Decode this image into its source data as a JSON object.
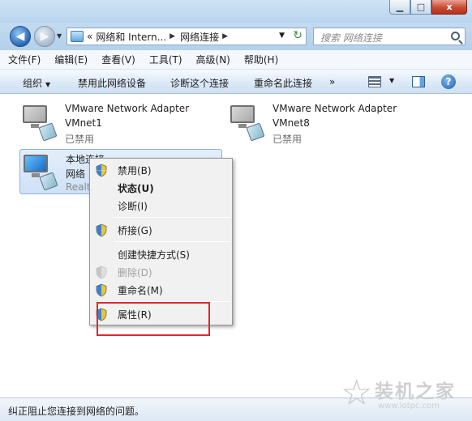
{
  "window": {
    "caption_minimize": "▁",
    "caption_maximize": "□",
    "caption_close": "x"
  },
  "address": {
    "prefix": "«",
    "breadcrumbs": [
      "网络和 Intern...",
      "网络连接"
    ],
    "search_placeholder": "搜索 网络连接"
  },
  "menubar": [
    "文件(F)",
    "编辑(E)",
    "查看(V)",
    "工具(T)",
    "高级(N)",
    "帮助(H)"
  ],
  "toolbar": {
    "organize": "组织",
    "disable_device": "禁用此网络设备",
    "diagnose": "诊断这个连接",
    "rename": "重命名此连接",
    "more": "»",
    "help": "?"
  },
  "adapters": [
    {
      "name": "VMware Network Adapter",
      "sub": "VMnet1",
      "status": "已禁用",
      "icon": "disabled-adapter-icon"
    },
    {
      "name": "VMware Network Adapter",
      "sub": "VMnet8",
      "status": "已禁用",
      "icon": "disabled-adapter-icon"
    },
    {
      "name": "本地连接",
      "sub": "网络",
      "status": "Realt",
      "icon": "local-connection-icon"
    }
  ],
  "context_menu": [
    {
      "label": "禁用(B)",
      "icon": "shield",
      "bold": false,
      "disabled": false
    },
    {
      "label": "状态(U)",
      "icon": null,
      "bold": true,
      "disabled": false
    },
    {
      "label": "诊断(I)",
      "icon": null,
      "bold": false,
      "disabled": false
    },
    {
      "label": "桥接(G)",
      "icon": "shield",
      "bold": false,
      "disabled": false
    },
    {
      "label": "创建快捷方式(S)",
      "icon": null,
      "bold": false,
      "disabled": false
    },
    {
      "label": "删除(D)",
      "icon": "shield",
      "bold": false,
      "disabled": true
    },
    {
      "label": "重命名(M)",
      "icon": "shield",
      "bold": false,
      "disabled": false
    },
    {
      "label": "属性(R)",
      "icon": "shield",
      "bold": false,
      "disabled": false
    }
  ],
  "statusbar": {
    "text": "纠正阻止您连接到网络的问题。"
  },
  "watermark": {
    "title": "装机之家",
    "url": "www.lotpc.com"
  },
  "colors": {
    "highlight": "#e0282e",
    "selection": "#cfe1f7"
  }
}
